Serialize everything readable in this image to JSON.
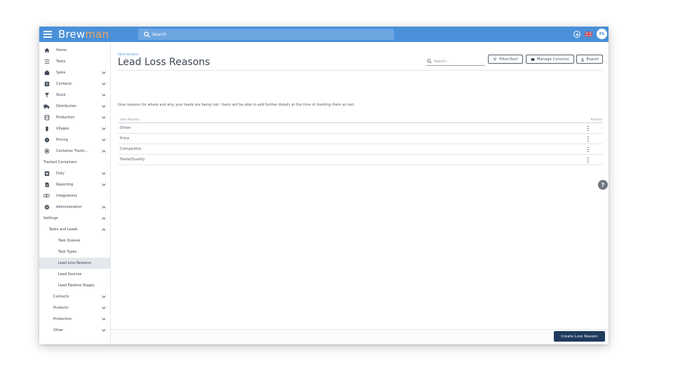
{
  "topbar": {
    "brand_main": "Brew",
    "brand_accent": "man",
    "search_placeholder": "Search",
    "avatar_initials": "PS"
  },
  "sidebar": {
    "items": [
      {
        "label": "Home",
        "icon": "home-icon",
        "chevron": "none"
      },
      {
        "label": "Tasks",
        "icon": "tasks-icon",
        "chevron": "none"
      },
      {
        "label": "Sales",
        "icon": "sales-icon",
        "chevron": "down"
      },
      {
        "label": "Contacts",
        "icon": "contacts-icon",
        "chevron": "down"
      },
      {
        "label": "Stock",
        "icon": "stock-icon",
        "chevron": "down"
      },
      {
        "label": "Distribution",
        "icon": "truck-icon",
        "chevron": "down"
      },
      {
        "label": "Production",
        "icon": "production-icon",
        "chevron": "down"
      },
      {
        "label": "Ullages",
        "icon": "ullages-icon",
        "chevron": "down"
      },
      {
        "label": "Pricing",
        "icon": "pricing-icon",
        "chevron": "down"
      },
      {
        "label": "Container Tracki...",
        "icon": "container-icon",
        "chevron": "up"
      },
      {
        "label": "Tracked Containers",
        "icon": "",
        "chevron": "none"
      },
      {
        "label": "Duty",
        "icon": "duty-icon",
        "chevron": "down"
      },
      {
        "label": "Reporting",
        "icon": "reporting-icon",
        "chevron": "down"
      },
      {
        "label": "Integrations",
        "icon": "link-icon",
        "chevron": "none"
      },
      {
        "label": "Administration",
        "icon": "gear-icon",
        "chevron": "up"
      },
      {
        "label": "Settings",
        "icon": "",
        "chevron": "up"
      },
      {
        "label": "Tasks and Leads",
        "icon": "",
        "chevron": "up"
      },
      {
        "label": "Task Queues",
        "icon": "",
        "chevron": "none"
      },
      {
        "label": "Task Types",
        "icon": "",
        "chevron": "none"
      },
      {
        "label": "Lead Loss Reasons",
        "icon": "",
        "chevron": "none",
        "active": true
      },
      {
        "label": "Lead Sources",
        "icon": "",
        "chevron": "none"
      },
      {
        "label": "Lead Pipeline Stages",
        "icon": "",
        "chevron": "none"
      },
      {
        "label": "Contacts",
        "icon": "",
        "chevron": "down"
      },
      {
        "label": "Products",
        "icon": "",
        "chevron": "down"
      },
      {
        "label": "Production",
        "icon": "",
        "chevron": "down"
      },
      {
        "label": "Other",
        "icon": "",
        "chevron": "down"
      }
    ]
  },
  "page": {
    "breadcrumb": "Administration",
    "title": "Lead Loss Reasons",
    "search_placeholder": "Search...",
    "filter_label": "Filter/Sort",
    "manage_columns_label": "Manage Columns",
    "export_label": "Export",
    "intro": "Give reasons for where and why your leads are being lost. Users will be able to add further details at the time of marking them as lost.",
    "columns": [
      "Loss Reason",
      "Actions"
    ],
    "rows": [
      "Other",
      "Price",
      "Competitor",
      "Taste/Quality"
    ],
    "create_label": "Create Loss Reason",
    "help_icon": "help-icon"
  },
  "colors": {
    "topbar": "#4a90d9",
    "brand_accent": "#f0a85e",
    "primary_button": "#1f3a5c"
  }
}
